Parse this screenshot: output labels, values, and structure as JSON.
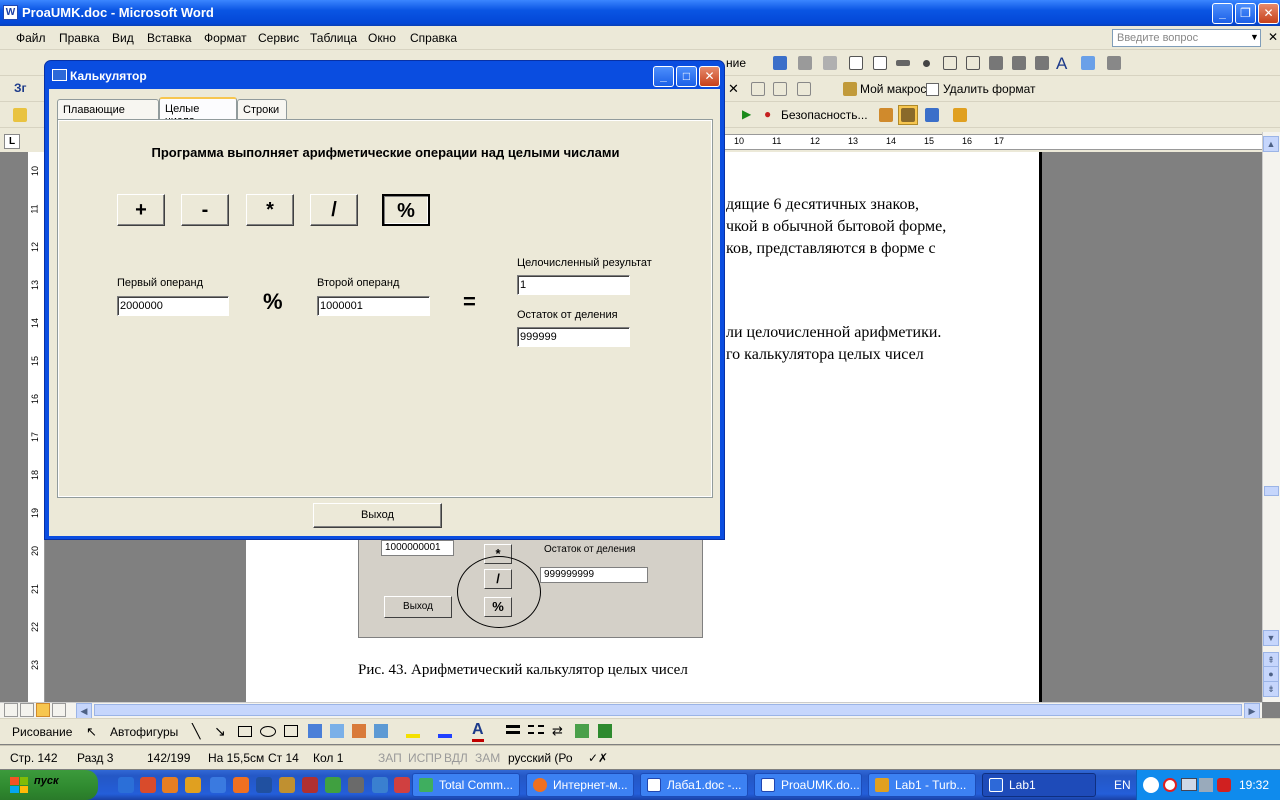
{
  "word": {
    "title": "ProaUMK.doc - Microsoft Word",
    "menu": [
      "Файл",
      "Правка",
      "Вид",
      "Вставка",
      "Формат",
      "Сервис",
      "Таблица",
      "Окно",
      "Справка"
    ],
    "ask_placeholder": "Введите вопрос",
    "toolbar2_partial": "ние",
    "my_macro": "Мой макрос",
    "delete_format": "Удалить формат",
    "security": "Безопасность...",
    "toolbar_left_3": "Зг",
    "hruler_ticks": [
      "10",
      "11",
      "12",
      "13",
      "14",
      "15",
      "16",
      "17"
    ],
    "vruler_ticks": [
      "10",
      "11",
      "12",
      "13",
      "14",
      "15",
      "16",
      "17",
      "18",
      "19",
      "20",
      "21",
      "22",
      "23"
    ],
    "doc_lines": [
      "дящие  6  десятичных  знаков,",
      "чкой в обычной бытовой форме,",
      "ков,  представляются  в  форме  с",
      "ли  целочисленной  арифметики.",
      "го   калькулятора   целых   чисел"
    ],
    "figure": {
      "operand": "1000000001",
      "btn_mul": "*",
      "btn_div": "/",
      "btn_mod": "%",
      "remainder_label": "Остаток от деления",
      "remainder_value": "999999999",
      "exit": "Выход"
    },
    "caption": "Рис.  43. Арифметический калькулятор целых  чисел"
  },
  "drawbar": {
    "drawing": "Рисование",
    "autoshapes": "Автофигуры"
  },
  "status": {
    "page": "Стр.  142",
    "section": "Разд  3",
    "pages": "142/199",
    "at": "На  15,5см",
    "line": "Ст  14",
    "col": "Кол  1",
    "rec": "ЗАП",
    "trk": "ИСПР",
    "ext": "ВДЛ",
    "ovr": "ЗАМ",
    "lang": "русский (Ро"
  },
  "taskbar": {
    "start": "пуск",
    "tasks": [
      "Total Comm...",
      "Интернет-м...",
      "Лаба1.doc -...",
      "ProaUMK.do...",
      "Lab1 - Turb...",
      "Lab1"
    ],
    "lang": "EN",
    "time": "19:32"
  },
  "dialog": {
    "title": "Калькулятор",
    "tabs": [
      "Плавающие числа",
      "Целые числа",
      "Строки"
    ],
    "heading": "Программа выполняет арифметические операции над целыми числами",
    "ops": [
      "+",
      "-",
      "*",
      "/",
      "%"
    ],
    "first_label": "Первый операнд",
    "first_value": "2000000",
    "op_symbol": "%",
    "second_label": "Второй операнд",
    "second_value": "1000001",
    "equals": "=",
    "result_label": "Целочисленный результат",
    "result_value": "1",
    "remainder_label": "Остаток от деления",
    "remainder_value": "999999",
    "exit": "Выход"
  }
}
